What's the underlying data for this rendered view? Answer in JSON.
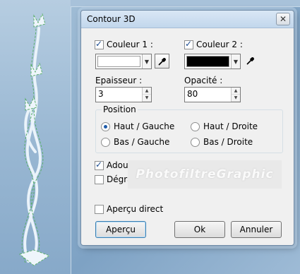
{
  "dialog": {
    "title": "Contour 3D",
    "close_glyph": "✕"
  },
  "colors": {
    "couleur1": "#ffffff",
    "couleur2": "#000000",
    "watermark_bg": "#e9e9e9"
  },
  "couleur1": {
    "label": "Couleur 1 :",
    "checked": true
  },
  "couleur2": {
    "label": "Couleur 2 :",
    "checked": true
  },
  "epaisseur": {
    "label": "Epaisseur :",
    "value": "3"
  },
  "opacite": {
    "label": "Opacité :",
    "value": "80"
  },
  "position": {
    "title": "Position",
    "options": [
      "Haut / Gauche",
      "Haut / Droite",
      "Bas / Gauche",
      "Bas / Droite"
    ],
    "selected": "Haut / Gauche"
  },
  "adoucir": {
    "label": "Adoucir",
    "checked": true
  },
  "degrade": {
    "label": "Dégradé",
    "checked": false
  },
  "watermark": "PhotofiltreGraphic",
  "apercu_direct": {
    "label": "Aperçu direct",
    "checked": false
  },
  "buttons": {
    "apercu": "Aperçu",
    "ok": "Ok",
    "annuler": "Annuler"
  },
  "icons": {
    "dropper": "eyedropper-icon",
    "dropdown": "chevron-down-icon",
    "close": "close-icon"
  }
}
